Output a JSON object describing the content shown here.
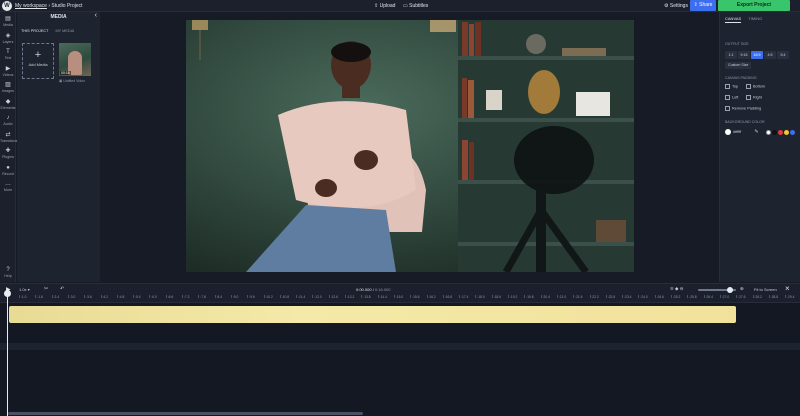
{
  "topbar": {
    "logo_letter": "W",
    "workspace": "My workspace",
    "separator": "›",
    "project": "Studio Project",
    "upload": "Upload",
    "subtitles": "Subtitles",
    "settings": "Settings",
    "share": "Share",
    "export": "Export Project"
  },
  "rail": [
    {
      "icon": "media-icon",
      "glyph": "▤",
      "label": "Media"
    },
    {
      "icon": "layers-icon",
      "glyph": "◈",
      "label": "Layers"
    },
    {
      "icon": "text-icon",
      "glyph": "T",
      "label": "Text"
    },
    {
      "icon": "videos-icon",
      "glyph": "▶",
      "label": "Videos"
    },
    {
      "icon": "images-icon",
      "glyph": "▨",
      "label": "Images"
    },
    {
      "icon": "elements-icon",
      "glyph": "◆",
      "label": "Elements"
    },
    {
      "icon": "audio-icon",
      "glyph": "♪",
      "label": "Audio"
    },
    {
      "icon": "transitions-icon",
      "glyph": "⇄",
      "label": "Transitions"
    },
    {
      "icon": "plugins-icon",
      "glyph": "✚",
      "label": "Plugins"
    },
    {
      "icon": "record-icon",
      "glyph": "●",
      "label": "Record"
    },
    {
      "icon": "more-icon",
      "glyph": "…",
      "label": "More"
    },
    {
      "icon": "help-icon",
      "glyph": "?",
      "label": "Help"
    }
  ],
  "media_panel": {
    "title": "MEDIA",
    "collapse_glyph": "‹",
    "tabs": [
      "THIS PROJECT",
      "MY MEDIA"
    ],
    "add_media": "Add Media",
    "clip_duration": "00:16",
    "clip_label": "Untitled Video"
  },
  "right_panel": {
    "tabs": [
      "CANVAS",
      "TIMING"
    ],
    "output_size_label": "OUTPUT SIZE",
    "ratios": [
      "1:1",
      "9:16",
      "16:9",
      "4:5",
      "5:4"
    ],
    "selected_ratio": "16:9",
    "custom_size": "Custom Size",
    "canvas_padding_label": "CANVAS PADDING",
    "padding": [
      "Top",
      "Bottom",
      "Left",
      "Right"
    ],
    "remove_padding": "Remove Padding",
    "bg_color_label": "BACKGROUND COLOR",
    "bg_hex": "#ffffff",
    "swatches": [
      "#ffffff",
      "#111111",
      "#e23b3b",
      "#f5c431",
      "#3d6ef0"
    ]
  },
  "transport": {
    "speed": "1.0x",
    "current_time": "0:00.000",
    "total_time": "0:16.000",
    "fit_to_screen": "Fit to Screen",
    "zoom_level": 0.85
  },
  "ruler": [
    ":1.0",
    ":1.6",
    ":2.4",
    ":3.0",
    ":3.6",
    ":4.2",
    ":4.8",
    ":5.4",
    ":6.0",
    ":6.6",
    ":7.2",
    ":7.8",
    ":8.4",
    ":9.0",
    ":9.6",
    ":10.2",
    ":10.8",
    ":11.4",
    ":12.0",
    ":12.6",
    ":13.2",
    ":13.8",
    ":14.4",
    ":15.0",
    ":15.6",
    ":16.2",
    ":16.8",
    ":17.4",
    ":18.0",
    ":18.6",
    ":19.2",
    ":19.8",
    ":20.4",
    ":21.0",
    ":21.6",
    ":22.2",
    ":22.8",
    ":23.4",
    ":24.0",
    ":24.6",
    ":25.2",
    ":25.8",
    ":26.4",
    ":27.0",
    ":27.6",
    ":28.2",
    ":28.8",
    ":29.4",
    ":30.0"
  ]
}
